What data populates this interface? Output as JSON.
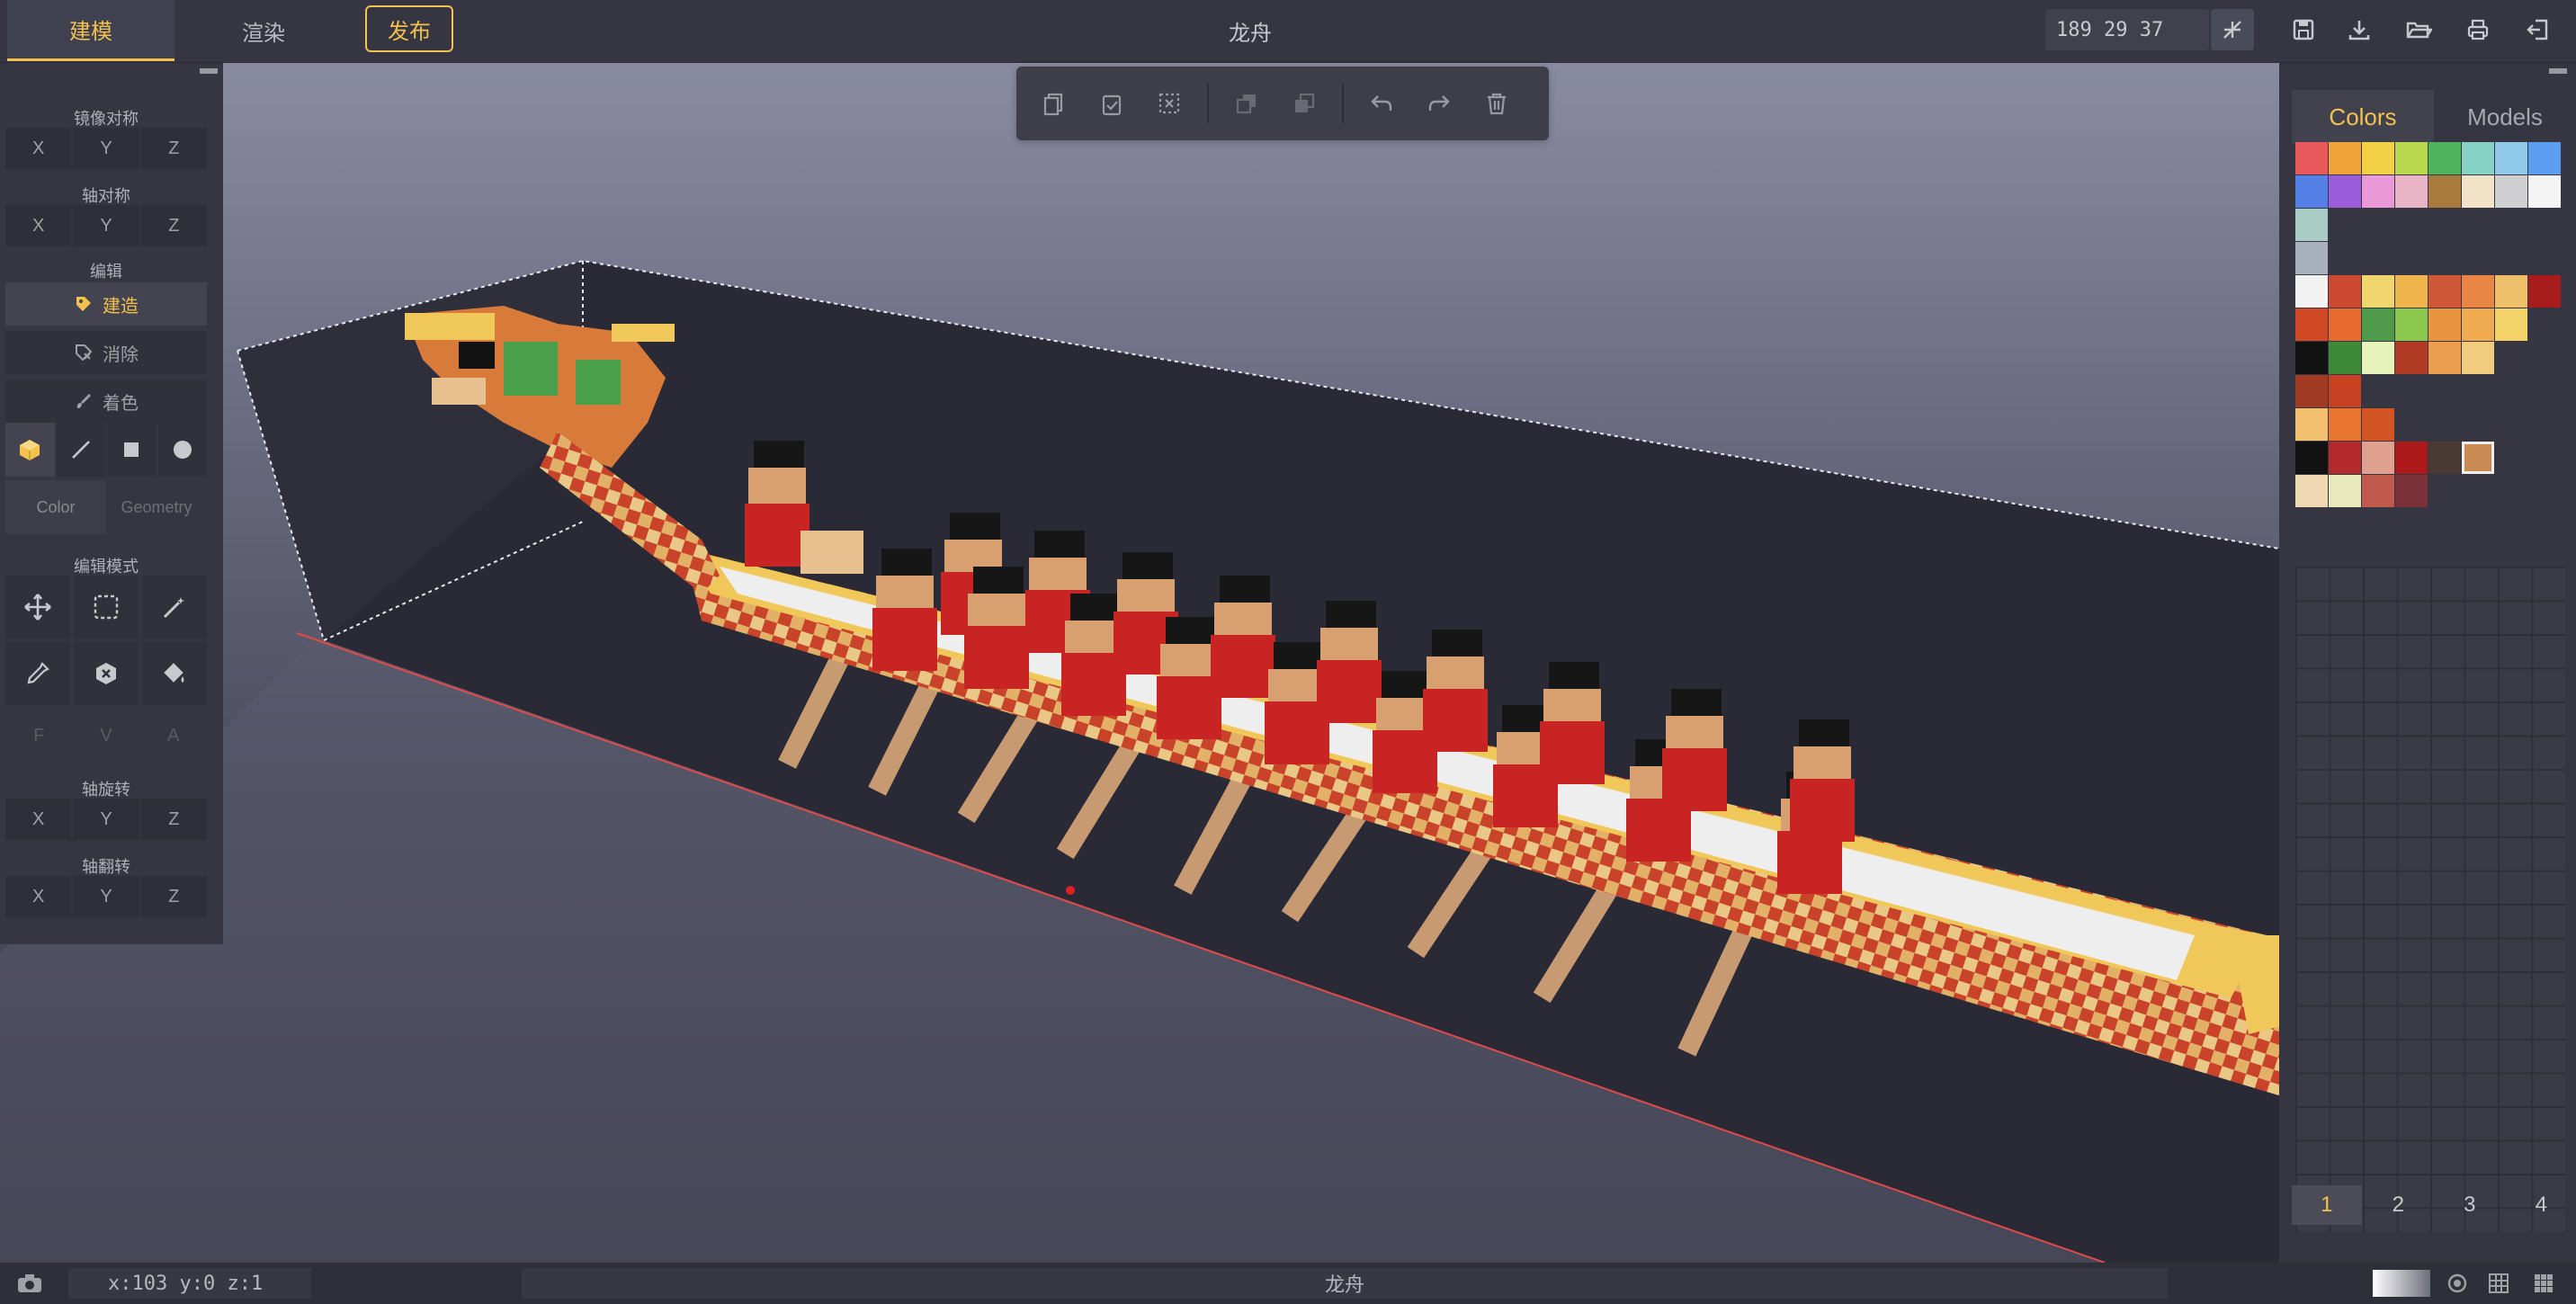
{
  "header": {
    "tabs": [
      {
        "label": "建模",
        "active": true
      },
      {
        "label": "渲染",
        "active": false
      }
    ],
    "publish_label": "发布",
    "title": "龙舟",
    "coords_value": "189 29 37",
    "icons": [
      "snap-icon",
      "save-icon",
      "download-icon",
      "open-folder-icon",
      "print-icon",
      "exit-icon"
    ]
  },
  "left_panel": {
    "mirror_label": "镜像对称",
    "axis_sym_label": "轴对称",
    "edit_label": "编辑",
    "tools": [
      "建造",
      "消除",
      "着色"
    ],
    "color_tab": "Color",
    "geometry_tab": "Geometry",
    "edit_mode_label": "编辑模式",
    "fva": [
      "F",
      "V",
      "A"
    ],
    "rotate_label": "轴旋转",
    "flip_label": "轴翻转",
    "axes": [
      "X",
      "Y",
      "Z"
    ]
  },
  "right_panel": {
    "tabs": [
      {
        "label": "Colors",
        "active": true
      },
      {
        "label": "Models",
        "active": false
      }
    ],
    "palette_rows": [
      [
        "#e9585a",
        "#efa23a",
        "#f4d046",
        "#b9d84e",
        "#4db35c",
        "#86d2c5",
        "#8fc8e8",
        "#5b9df0"
      ],
      [
        "#5480e8",
        "#9a5cd8",
        "#e99ad6",
        "#e8b4c6",
        "#a87a3c",
        "#f2e2c8",
        "#cfcfd2",
        "#f4f4f4"
      ],
      [
        "#a9cdc4"
      ],
      [
        "#a8b2bc"
      ],
      [
        "#f2f2f2",
        "#cc4830",
        "#f1d56e",
        "#f0b44c",
        "#cf5838",
        "#e98646",
        "#eec06c",
        "#a81c1c"
      ],
      [
        "#d04824",
        "#e76a2e",
        "#4e9a4a",
        "#8cc84e",
        "#e8943e",
        "#f0aa50",
        "#f4d26a"
      ],
      [
        "#121212",
        "#3e8a38",
        "#e6f4bc",
        "#b03a24",
        "#ec9e50",
        "#f2cc7e"
      ],
      [
        "#a13a22",
        "#c74022"
      ],
      [
        "#f2c070",
        "#e8762e",
        "#d25424"
      ],
      [
        "#121212",
        "#b42a2a",
        "#e0a090",
        "#ad1818",
        "#4a3a34",
        "#c98a54"
      ],
      [
        "#f0d8b2",
        "#e8eabc",
        "#c05a4c",
        "#7a3238"
      ]
    ],
    "selected_swatch": "#c98a54",
    "page_tabs": [
      "1",
      "2",
      "3",
      "4"
    ],
    "active_page": "1"
  },
  "status_bar": {
    "cursor_position": "x:103 y:0 z:1",
    "title": "龙舟",
    "icons": [
      "camera-icon",
      "light-icon",
      "grid-icon",
      "layout-icon"
    ]
  }
}
